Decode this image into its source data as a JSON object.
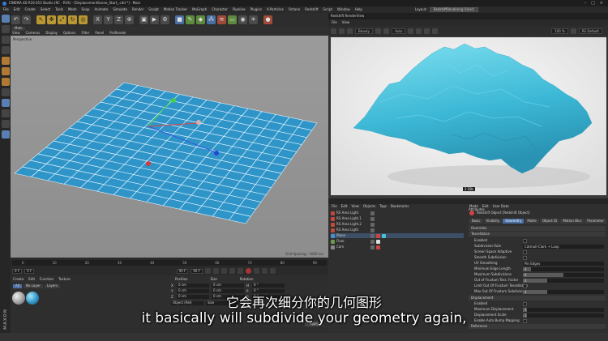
{
  "window": {
    "title": "CINEMA 4D R19.053 Studio (RC - R19) - [DisplacementScene_Start_.c4d *] - Main",
    "controls": [
      "–",
      "□",
      "×"
    ]
  },
  "menubar": {
    "items": [
      "File",
      "Edit",
      "Create",
      "Select",
      "Tools",
      "Mesh",
      "Snap",
      "Animate",
      "Simulate",
      "Render",
      "Sculpt",
      "Motion Tracker",
      "MoGraph",
      "Character",
      "Pipeline",
      "Plugins",
      "X-Particles",
      "Octane",
      "Redshift",
      "Script",
      "Window",
      "Help"
    ],
    "layout_label": "Layout:",
    "layout_value": "RedshiftRendering (User)"
  },
  "viewport": {
    "tab": "Main",
    "menu": [
      "View",
      "Cameras",
      "Display",
      "Options",
      "Filter",
      "Panel",
      "ProRender"
    ],
    "label": "Perspective",
    "grid_spacing": "Grid Spacing : 1000 cm"
  },
  "timeline": {
    "ticks": [
      "0",
      "10",
      "20",
      "30",
      "40",
      "50",
      "60",
      "70",
      "80",
      "90"
    ],
    "start": "0 F",
    "current": "0 F",
    "end": "90 F",
    "end2": "90 F"
  },
  "material_manager": {
    "menu": [
      "Create",
      "Edit",
      "Function",
      "Texture"
    ],
    "filters": [
      "All",
      "No Layer",
      "Layers"
    ]
  },
  "coordinates": {
    "headers": [
      "Position",
      "Size",
      "Rotation"
    ],
    "rows": [
      {
        "axis": "X",
        "pos": "0 cm",
        "size": "0 cm",
        "rot_axis": "H",
        "rot": "0 °"
      },
      {
        "axis": "Y",
        "pos": "0 cm",
        "size": "0 cm",
        "rot_axis": "P",
        "rot": "0 °"
      },
      {
        "axis": "Z",
        "pos": "0 cm",
        "size": "0 cm",
        "rot_axis": "B",
        "rot": "0 °"
      }
    ],
    "mode": "Object (Rel)",
    "size_mode": "Size",
    "apply": "Apply"
  },
  "render_view": {
    "title": "Redshift RenderView",
    "menu": [
      "File",
      "View"
    ],
    "dropdown1": "Beauty",
    "dropdown2": "Auto",
    "zoom": "100 %",
    "preset": "RS Default",
    "badge": "2.58s"
  },
  "progress": {
    "label": "Progressive Rendering..."
  },
  "object_manager": {
    "menu": [
      "File",
      "Edit",
      "View",
      "Objects",
      "Tags",
      "Bookmarks"
    ],
    "objects": [
      {
        "name": "RS Area Light",
        "color": "#c04a3a"
      },
      {
        "name": "RS Area Light.1",
        "color": "#c04a3a"
      },
      {
        "name": "RS Area Light.2",
        "color": "#c04a3a"
      },
      {
        "name": "RS Area Light",
        "color": "#c04a3a"
      },
      {
        "name": "Plane",
        "color": "#4a8fd0"
      },
      {
        "name": "Floor",
        "color": "#6d9b47"
      },
      {
        "name": "Cam",
        "color": "#888888"
      }
    ]
  },
  "attributes": {
    "header": "Attributes",
    "menu": [
      "Mode",
      "Edit",
      "User Data"
    ],
    "object": "Redshift Object [Redshift Object]",
    "tabs": [
      "Basic",
      "Visibility",
      "Geometry",
      "Matte",
      "Object ID",
      "Motion Blur",
      "Parameter"
    ],
    "section1": "Overrides",
    "section2": "Tessellation",
    "props": [
      {
        "label": "Enabled",
        "type": "check"
      },
      {
        "label": "Subdivision Rule",
        "value": "Catmull-Clark + Loop"
      },
      {
        "label": "Screen Space Adaptive",
        "type": "check"
      },
      {
        "label": "Smooth Subdivision",
        "type": "check"
      },
      {
        "label": "UV Smoothing",
        "value": "Pin Edges"
      },
      {
        "label": "Minimum Edge Length",
        "value": "4",
        "fill": 0.1
      },
      {
        "label": "Maximum Subdivisions",
        "value": "6",
        "fill": 0.5
      },
      {
        "label": "Out of Frustum Tess. Factor",
        "value": "4",
        "fill": 0.3
      },
      {
        "label": "Limit Out Of Frustum Tessellation",
        "type": "check"
      },
      {
        "label": "Max Out Of Frustum Subdivisions",
        "value": "4",
        "fill": 0.3
      }
    ],
    "section3": "Displacement",
    "disp_props": [
      {
        "label": "Enabled",
        "type": "check"
      },
      {
        "label": "Maximum Displacement",
        "value": "1",
        "fill": 0.05
      },
      {
        "label": "Displacement Scale",
        "value": "1",
        "fill": 0.05
      },
      {
        "label": "Enable Auto Bump Mapping",
        "type": "check"
      }
    ],
    "section4": "Reference",
    "ref_label": "Source",
    "ref_value": "Auto",
    "ref_btn1": "Capture",
    "ref_btn2": "Clear"
  },
  "subtitles": {
    "zh": "它会再次细分你的几何图形",
    "en": "it basically will subdivide your geometry again,"
  },
  "colors": {
    "plane": "#2f95c8",
    "mesh": "#4cc0d8",
    "accent": "#4a6fa5"
  }
}
